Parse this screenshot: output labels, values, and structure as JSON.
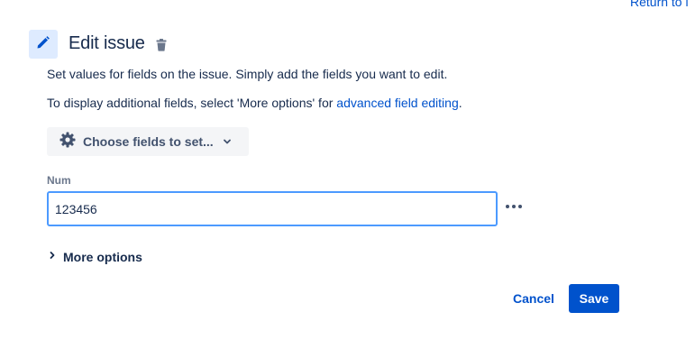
{
  "header": {
    "return_link": "Return to i",
    "title": "Edit issue"
  },
  "description": {
    "line1": "Set values for fields on the issue. Simply add the fields you want to edit.",
    "line2_prefix": "To display additional fields, select 'More options' for ",
    "line2_link": "advanced field editing",
    "line2_suffix": "."
  },
  "choose_fields": {
    "label": "Choose fields to set..."
  },
  "field": {
    "label": "Num",
    "value": "123456"
  },
  "more_options": {
    "label": "More options"
  },
  "actions": {
    "cancel_label": "Cancel",
    "save_label": "Save"
  },
  "icons": {
    "header": "pencil-icon",
    "delete": "trash-icon",
    "choose": "gear-icon",
    "choose_dropdown": "chevron-down-icon",
    "field_menu": "more-horizontal-icon",
    "expand": "chevron-right-icon"
  },
  "colors": {
    "primary": "#0052CC",
    "text": "#172B4D",
    "subtle_text": "#6B778C",
    "focus_border": "#4C9AFF",
    "icon_bg": "#DEEBFF",
    "button_bg": "#F4F5F7"
  }
}
